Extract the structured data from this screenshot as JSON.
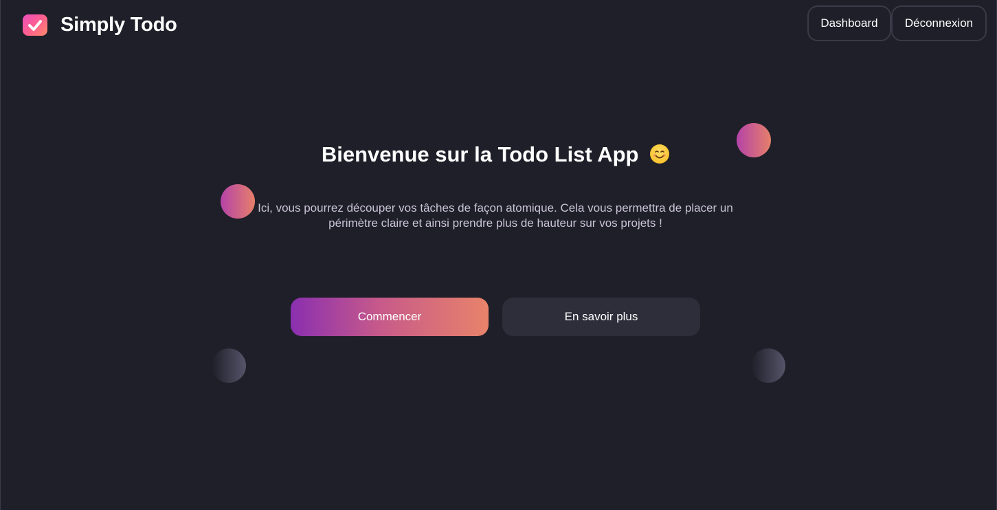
{
  "header": {
    "app_name": "Simply Todo",
    "nav": {
      "dashboard_label": "Dashboard",
      "logout_label": "Déconnexion"
    }
  },
  "hero": {
    "title": "Bienvenue sur la Todo List App",
    "title_emoji": "smiling-face-icon",
    "subtitle": "Ici, vous pourrez découper vos tâches de façon atomique. Cela vous permettra de placer un périmètre claire et ainsi prendre plus de hauteur sur vos projets !",
    "primary_cta": "Commencer",
    "secondary_cta": "En savoir plus"
  },
  "colors": {
    "background": "#1f1f29",
    "accent_gradient_start": "#8a2fb0",
    "accent_gradient_end": "#e8836a",
    "secondary_button": "#2e2e3b",
    "text_muted": "#c9c4d6"
  }
}
